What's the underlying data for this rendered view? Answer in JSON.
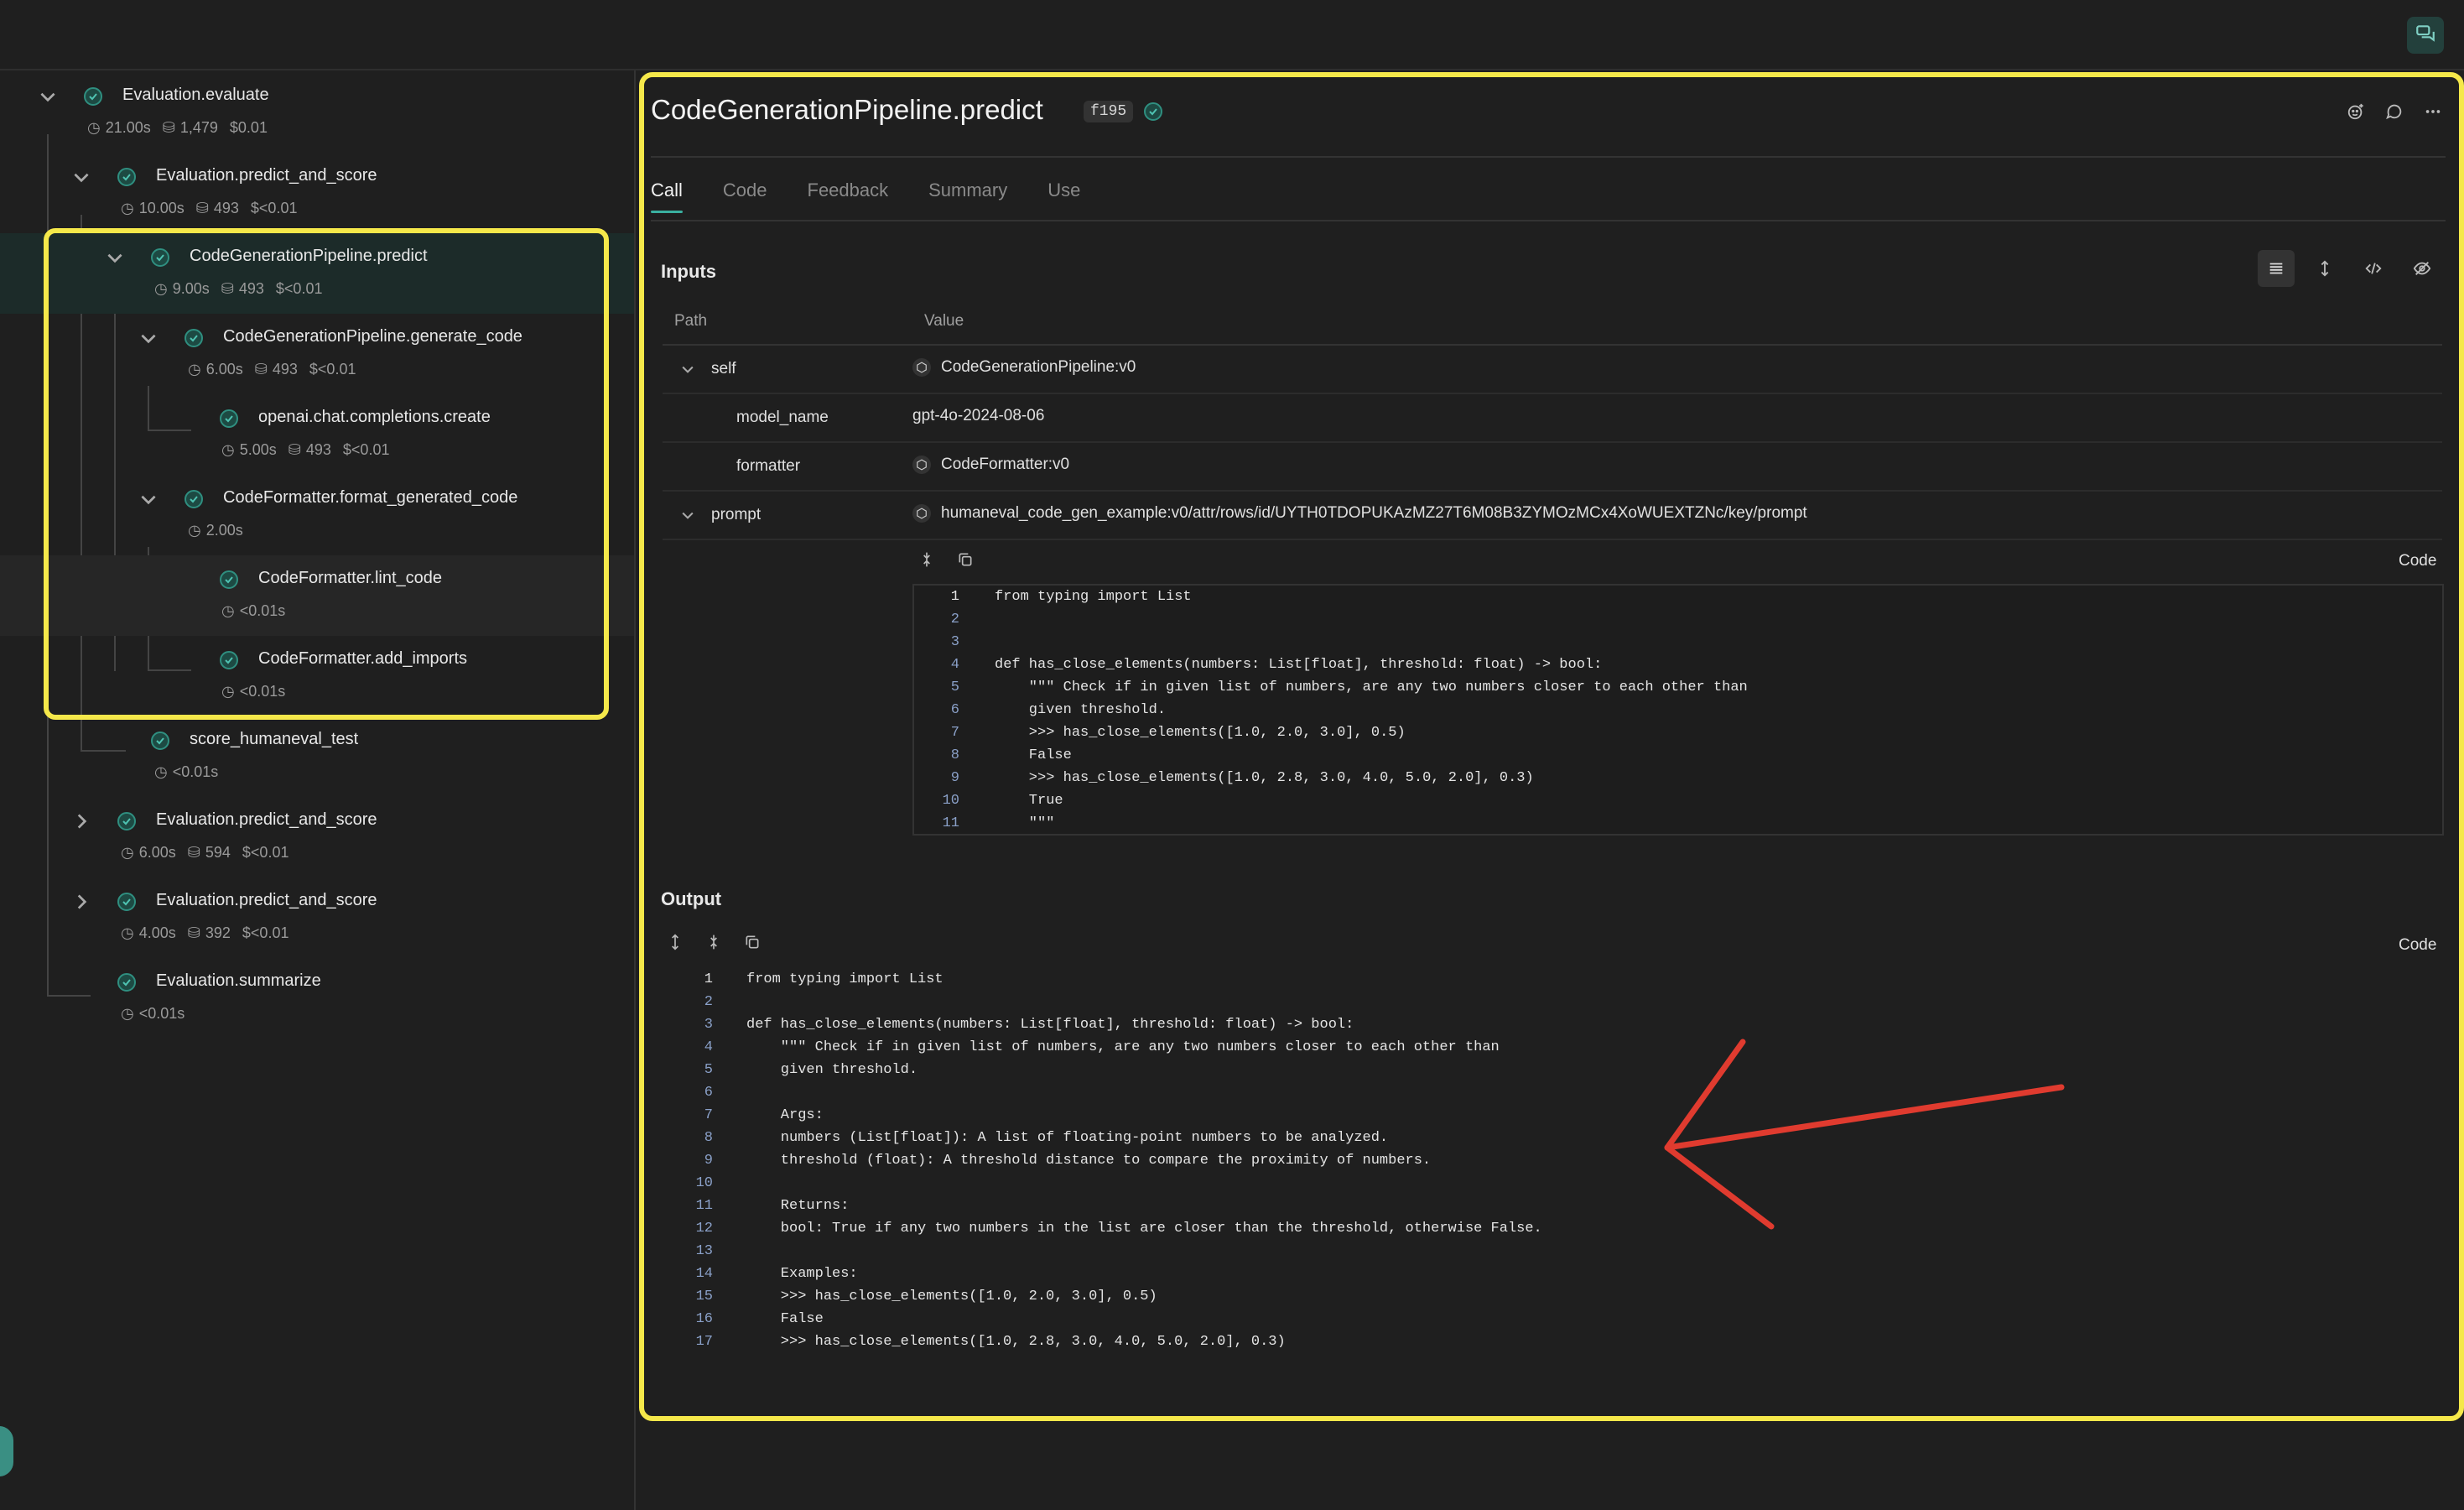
{
  "tree": [
    {
      "name": "Evaluation.evaluate",
      "time": "21.00s",
      "tokens": "1,479",
      "cost": "$0.01"
    },
    {
      "name": "Evaluation.predict_and_score",
      "time": "10.00s",
      "tokens": "493",
      "cost": "$<0.01"
    },
    {
      "name": "CodeGenerationPipeline.predict",
      "time": "9.00s",
      "tokens": "493",
      "cost": "$<0.01"
    },
    {
      "name": "CodeGenerationPipeline.generate_code",
      "time": "6.00s",
      "tokens": "493",
      "cost": "$<0.01"
    },
    {
      "name": "openai.chat.completions.create",
      "time": "5.00s",
      "tokens": "493",
      "cost": "$<0.01"
    },
    {
      "name": "CodeFormatter.format_generated_code",
      "time": "2.00s"
    },
    {
      "name": "CodeFormatter.lint_code",
      "time": "<0.01s"
    },
    {
      "name": "CodeFormatter.add_imports",
      "time": "<0.01s"
    },
    {
      "name": "score_humaneval_test",
      "time": "<0.01s"
    },
    {
      "name": "Evaluation.predict_and_score",
      "time": "6.00s",
      "tokens": "594",
      "cost": "$<0.01"
    },
    {
      "name": "Evaluation.predict_and_score",
      "time": "4.00s",
      "tokens": "392",
      "cost": "$<0.01"
    },
    {
      "name": "Evaluation.summarize",
      "time": "<0.01s"
    }
  ],
  "detail": {
    "title": "CodeGenerationPipeline.predict",
    "id_badge": "f195",
    "tabs": [
      "Call",
      "Code",
      "Feedback",
      "Summary",
      "Use"
    ],
    "inputs_title": "Inputs",
    "col_path": "Path",
    "col_value": "Value",
    "rows": [
      {
        "path": "self",
        "value": "CodeGenerationPipeline:v0"
      },
      {
        "path": "model_name",
        "value": "gpt-4o-2024-08-06"
      },
      {
        "path": "formatter",
        "value": "CodeFormatter:v0"
      },
      {
        "path": "prompt",
        "value": "humaneval_code_gen_example:v0/attr/rows/id/UYTH0TDOPUKAzMZ27T6M08B3ZYMOzMCx4XoWUEXTZNc/key/prompt"
      }
    ],
    "code_label": "Code",
    "prompt_code": [
      "from typing import List",
      "",
      "",
      "def has_close_elements(numbers: List[float], threshold: float) -> bool:",
      "    \"\"\" Check if in given list of numbers, are any two numbers closer to each other than",
      "    given threshold.",
      "    >>> has_close_elements([1.0, 2.0, 3.0], 0.5)",
      "    False",
      "    >>> has_close_elements([1.0, 2.8, 3.0, 4.0, 5.0, 2.0], 0.3)",
      "    True",
      "    \"\"\""
    ],
    "output_title": "Output",
    "output_code": [
      "from typing import List",
      "",
      "def has_close_elements(numbers: List[float], threshold: float) -> bool:",
      "    \"\"\" Check if in given list of numbers, are any two numbers closer to each other than",
      "    given threshold.",
      "",
      "    Args:",
      "    numbers (List[float]): A list of floating-point numbers to be analyzed.",
      "    threshold (float): A threshold distance to compare the proximity of numbers.",
      "",
      "    Returns:",
      "    bool: True if any two numbers in the list are closer than the threshold, otherwise False.",
      "",
      "    Examples:",
      "    >>> has_close_elements([1.0, 2.0, 3.0], 0.5)",
      "    False",
      "    >>> has_close_elements([1.0, 2.8, 3.0, 4.0, 5.0, 2.0], 0.3)"
    ]
  },
  "colors": {
    "accent": "#3ab0a0",
    "highlight": "#f5e84a",
    "annotation_arrow": "#e03b2f"
  }
}
